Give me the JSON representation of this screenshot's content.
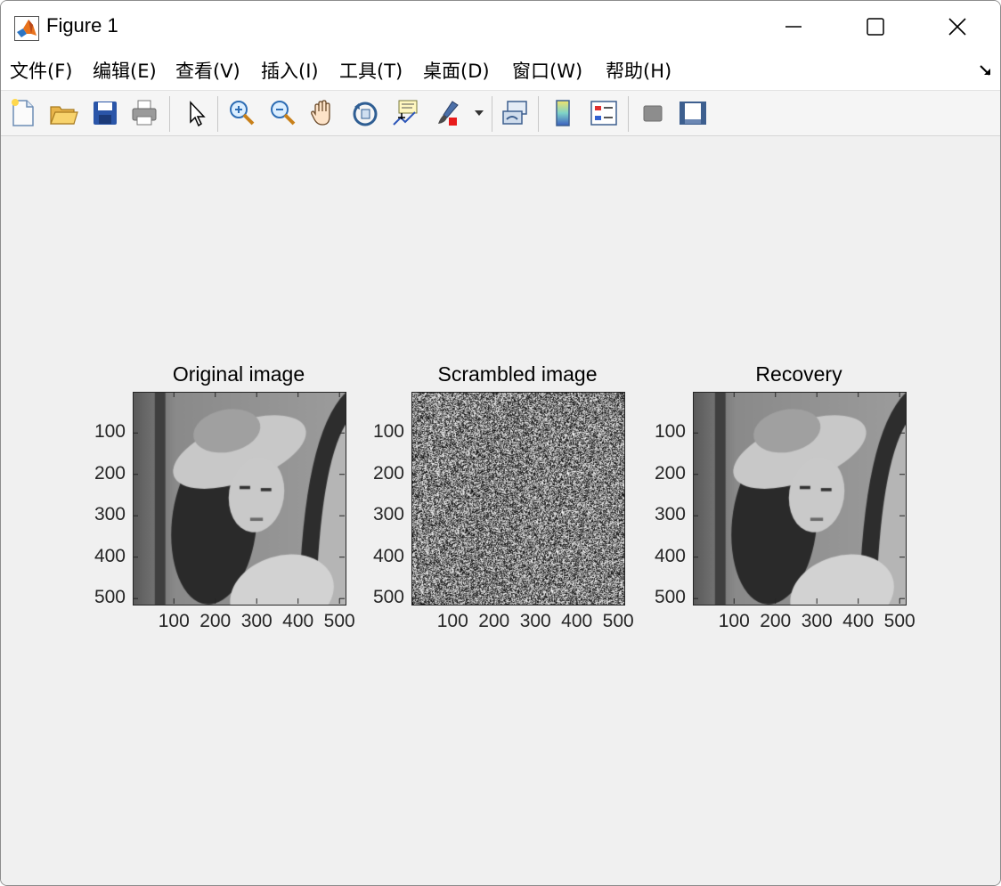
{
  "window": {
    "title": "Figure 1"
  },
  "menu": {
    "items": [
      {
        "name": "menu-file",
        "label": "文件(F)"
      },
      {
        "name": "menu-edit",
        "label": "编辑(E)"
      },
      {
        "name": "menu-view",
        "label": "查看(V)"
      },
      {
        "name": "menu-insert",
        "label": "插入(I)"
      },
      {
        "name": "menu-tools",
        "label": "工具(T)"
      },
      {
        "name": "menu-desktop",
        "label": "桌面(D)"
      },
      {
        "name": "menu-window",
        "label": "窗口(W)"
      },
      {
        "name": "menu-help",
        "label": "帮助(H)"
      }
    ]
  },
  "toolbar": {
    "buttons": [
      "new-figure-icon",
      "open-file-icon",
      "save-figure-icon",
      "print-figure-icon",
      "edit-plot-icon",
      "zoom-in-icon",
      "zoom-out-icon",
      "pan-icon",
      "rotate-3d-icon",
      "data-cursor-icon",
      "brush-icon",
      "link-plot-icon",
      "colorbar-icon",
      "legend-icon",
      "hide-plot-tools-icon",
      "show-plot-tools-icon"
    ]
  },
  "chart_data": [
    {
      "type": "image",
      "title": "Original image",
      "xticks": [
        "100",
        "200",
        "300",
        "400",
        "500"
      ],
      "yticks": [
        "100",
        "200",
        "300",
        "400",
        "500"
      ],
      "xlim": [
        0.5,
        512.5
      ],
      "ylim": [
        0.5,
        512.5
      ],
      "colormap": "gray",
      "content": "grayscale photograph"
    },
    {
      "type": "image",
      "title": "Scrambled image",
      "xticks": [
        "100",
        "200",
        "300",
        "400",
        "500"
      ],
      "yticks": [
        "100",
        "200",
        "300",
        "400",
        "500"
      ],
      "xlim": [
        0.5,
        512.5
      ],
      "ylim": [
        0.5,
        512.5
      ],
      "colormap": "gray",
      "content": "random noise"
    },
    {
      "type": "image",
      "title": "Recovery",
      "xticks": [
        "100",
        "200",
        "300",
        "400",
        "500"
      ],
      "yticks": [
        "100",
        "200",
        "300",
        "400",
        "500"
      ],
      "xlim": [
        0.5,
        512.5
      ],
      "ylim": [
        0.5,
        512.5
      ],
      "colormap": "gray",
      "content": "grayscale photograph"
    }
  ]
}
